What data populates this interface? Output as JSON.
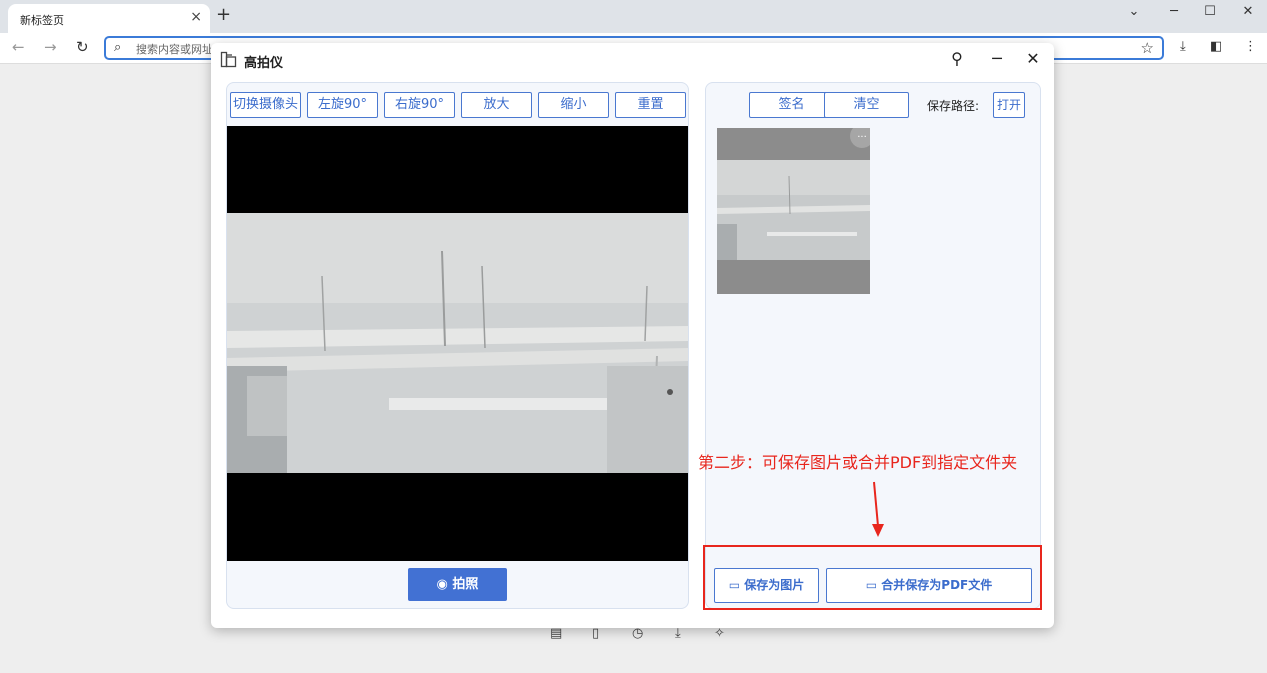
{
  "browser": {
    "tab_title": "新标签页",
    "tab_close": "×",
    "new_tab": "+",
    "omnibox_placeholder": "搜索内容或网址"
  },
  "dialog": {
    "title": "高拍仪"
  },
  "camera_toolbar": {
    "switch_camera": "切换摄像头",
    "rotate_left": "左旋90°",
    "rotate_right": "右旋90°",
    "zoom_in": "放大",
    "zoom_out": "缩小",
    "reset": "重置"
  },
  "capture": {
    "shoot_label": "拍照"
  },
  "right_toolbar": {
    "sign": "签名",
    "clear": "清空",
    "save_path_label": "保存路径:",
    "open": "打开"
  },
  "thumbnail": {
    "more": "···"
  },
  "save_actions": {
    "save_image": "保存为图片",
    "merge_pdf": "合并保存为PDF文件"
  },
  "annotation": {
    "text": "第二步：可保存图片或合并PDF到指定文件夹",
    "color": "#e8261d"
  },
  "colors": {
    "accent": "#4271d3"
  }
}
